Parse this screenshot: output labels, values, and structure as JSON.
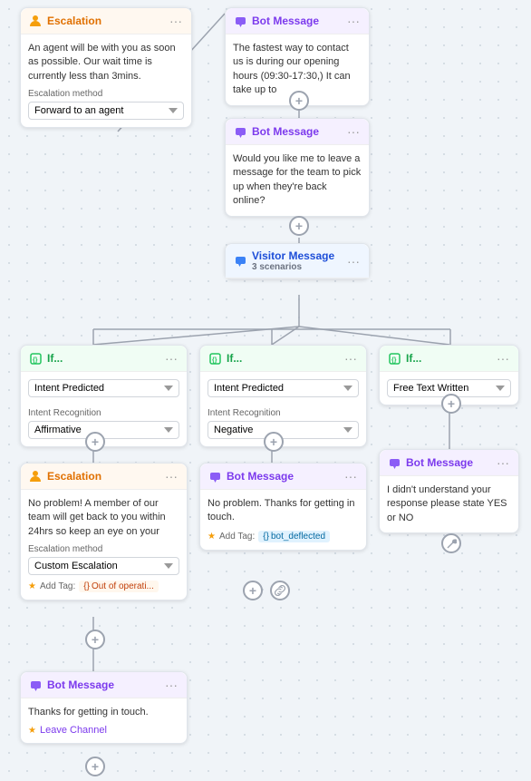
{
  "cards": {
    "escalation_top": {
      "title": "Escalation",
      "body": "An agent will be with you as soon as possible. Our wait time is currently less than 3mins.",
      "method_label": "Escalation method",
      "method_value": "Forward to an agent"
    },
    "bot_msg_1": {
      "title": "Bot Message",
      "body": "The fastest way to contact us is during our opening hours (09:30-17:30,) It can take up to"
    },
    "bot_msg_2": {
      "title": "Bot Message",
      "body": "Would you like me to leave a message for the team to pick up when they're back online?"
    },
    "visitor_msg": {
      "title": "Visitor Message",
      "scenarios": "3 scenarios"
    },
    "if_1": {
      "title": "If...",
      "label1": "Intent Predicted",
      "label2": "Intent Recognition",
      "value": "Affirmative"
    },
    "if_2": {
      "title": "If...",
      "label1": "Intent Predicted",
      "label2": "Intent Recognition",
      "value": "Negative"
    },
    "if_3": {
      "title": "If...",
      "label1": "Free Text Written"
    },
    "bot_msg_3": {
      "title": "Bot Message",
      "body": "I didn't understand your response please state YES or NO"
    },
    "escalation_2": {
      "title": "Escalation",
      "body": "No problem! A member of our team will get back to you within 24hrs so keep an eye on your",
      "method_label": "Escalation method",
      "method_value": "Custom Escalation",
      "add_tag_label": "Add Tag:",
      "tag_value": "Out of operati..."
    },
    "bot_msg_4": {
      "title": "Bot Message",
      "body": "No problem. Thanks for getting in touch.",
      "add_tag_label": "Add Tag:",
      "tag_value": "bot_deflected"
    },
    "bot_msg_5": {
      "title": "Bot Message",
      "body": "Thanks for getting in touch.",
      "leave_channel": "Leave Channel"
    }
  },
  "icons": {
    "escalation": "👤",
    "bot": "💬",
    "visitor": "💬",
    "if": "{}",
    "more": "•••",
    "plus": "+",
    "link": "🔗",
    "wrench": "🔧",
    "tag": "{}"
  },
  "colors": {
    "escalation_accent": "#f59e0b",
    "bot_accent": "#8b5cf6",
    "visitor_accent": "#3b82f6",
    "if_accent": "#22c55e",
    "connector": "#9ca3af"
  }
}
